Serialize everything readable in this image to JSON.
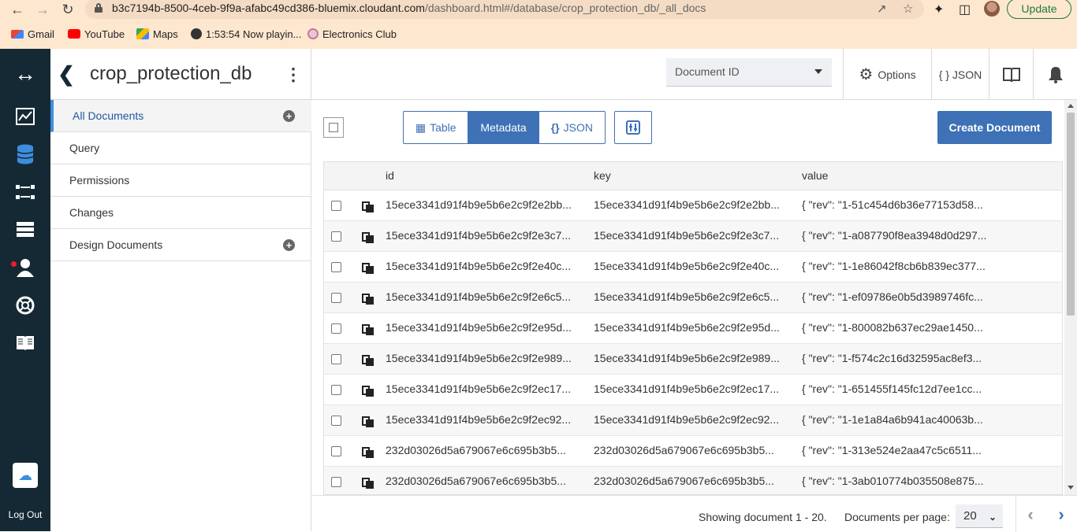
{
  "browser": {
    "url_host": "b3c7194b-8500-4ceb-9f9a-afabc49cd386-bluemix.cloudant.com",
    "url_path": "/dashboard.html#/database/crop_protection_db/_all_docs",
    "update_label": "Update",
    "bookmarks": [
      {
        "label": "Gmail",
        "icon": "gmail-icon",
        "color": "#ea4335"
      },
      {
        "label": "YouTube",
        "icon": "youtube-icon",
        "color": "#ff0000"
      },
      {
        "label": "Maps",
        "icon": "maps-icon",
        "color": "#34a853"
      },
      {
        "label": "1:53:54 Now playin...",
        "icon": "globe-icon",
        "color": "#333333"
      },
      {
        "label": "Electronics Club",
        "icon": "club-icon",
        "color": "#c07a9e"
      }
    ]
  },
  "rail": {
    "logout_label": "Log Out",
    "icons": [
      "expand-icon",
      "monitoring-icon",
      "database-icon",
      "replication-icon",
      "active-tasks-icon",
      "account-icon",
      "support-icon",
      "docs-icon"
    ]
  },
  "header": {
    "db_name": "crop_protection_db",
    "doc_select_placeholder": "Document ID",
    "options_label": "Options",
    "json_label": "{ } JSON"
  },
  "sidebar": {
    "items": [
      {
        "label": "All Documents",
        "active": true,
        "addable": true
      },
      {
        "label": "Query",
        "active": false,
        "addable": false
      },
      {
        "label": "Permissions",
        "active": false,
        "addable": false
      },
      {
        "label": "Changes",
        "active": false,
        "addable": false
      },
      {
        "label": "Design Documents",
        "active": false,
        "addable": true
      }
    ]
  },
  "toolbar": {
    "view_table": "Table",
    "view_metadata": "Metadata",
    "view_json": "JSON",
    "create_label": "Create Document"
  },
  "table": {
    "columns": [
      "id",
      "key",
      "value"
    ],
    "rows": [
      {
        "id": "15ece3341d91f4b9e5b6e2c9f2e2bb...",
        "key": "15ece3341d91f4b9e5b6e2c9f2e2bb...",
        "value": "{ \"rev\": \"1-51c454d6b36e77153d58..."
      },
      {
        "id": "15ece3341d91f4b9e5b6e2c9f2e3c7...",
        "key": "15ece3341d91f4b9e5b6e2c9f2e3c7...",
        "value": "{ \"rev\": \"1-a087790f8ea3948d0d297..."
      },
      {
        "id": "15ece3341d91f4b9e5b6e2c9f2e40c...",
        "key": "15ece3341d91f4b9e5b6e2c9f2e40c...",
        "value": "{ \"rev\": \"1-1e86042f8cb6b839ec377..."
      },
      {
        "id": "15ece3341d91f4b9e5b6e2c9f2e6c5...",
        "key": "15ece3341d91f4b9e5b6e2c9f2e6c5...",
        "value": "{ \"rev\": \"1-ef09786e0b5d3989746fc..."
      },
      {
        "id": "15ece3341d91f4b9e5b6e2c9f2e95d...",
        "key": "15ece3341d91f4b9e5b6e2c9f2e95d...",
        "value": "{ \"rev\": \"1-800082b637ec29ae1450..."
      },
      {
        "id": "15ece3341d91f4b9e5b6e2c9f2e989...",
        "key": "15ece3341d91f4b9e5b6e2c9f2e989...",
        "value": "{ \"rev\": \"1-f574c2c16d32595ac8ef3..."
      },
      {
        "id": "15ece3341d91f4b9e5b6e2c9f2ec17...",
        "key": "15ece3341d91f4b9e5b6e2c9f2ec17...",
        "value": "{ \"rev\": \"1-651455f145fc12d7ee1cc..."
      },
      {
        "id": "15ece3341d91f4b9e5b6e2c9f2ec92...",
        "key": "15ece3341d91f4b9e5b6e2c9f2ec92...",
        "value": "{ \"rev\": \"1-1e1a84a6b941ac40063b..."
      },
      {
        "id": "232d03026d5a679067e6c695b3b5...",
        "key": "232d03026d5a679067e6c695b3b5...",
        "value": "{ \"rev\": \"1-313e524e2aa47c5c6511..."
      },
      {
        "id": "232d03026d5a679067e6c695b3b5...",
        "key": "232d03026d5a679067e6c695b3b5...",
        "value": "{ \"rev\": \"1-3ab010774b035508e875..."
      }
    ]
  },
  "footer": {
    "showing_text": "Showing document 1 - 20.",
    "per_page_label": "Documents per page:",
    "per_page_value": "20"
  },
  "colors": {
    "rail_bg": "#152935",
    "accent": "#3e71b5",
    "browser_bg": "#fde7cf"
  }
}
